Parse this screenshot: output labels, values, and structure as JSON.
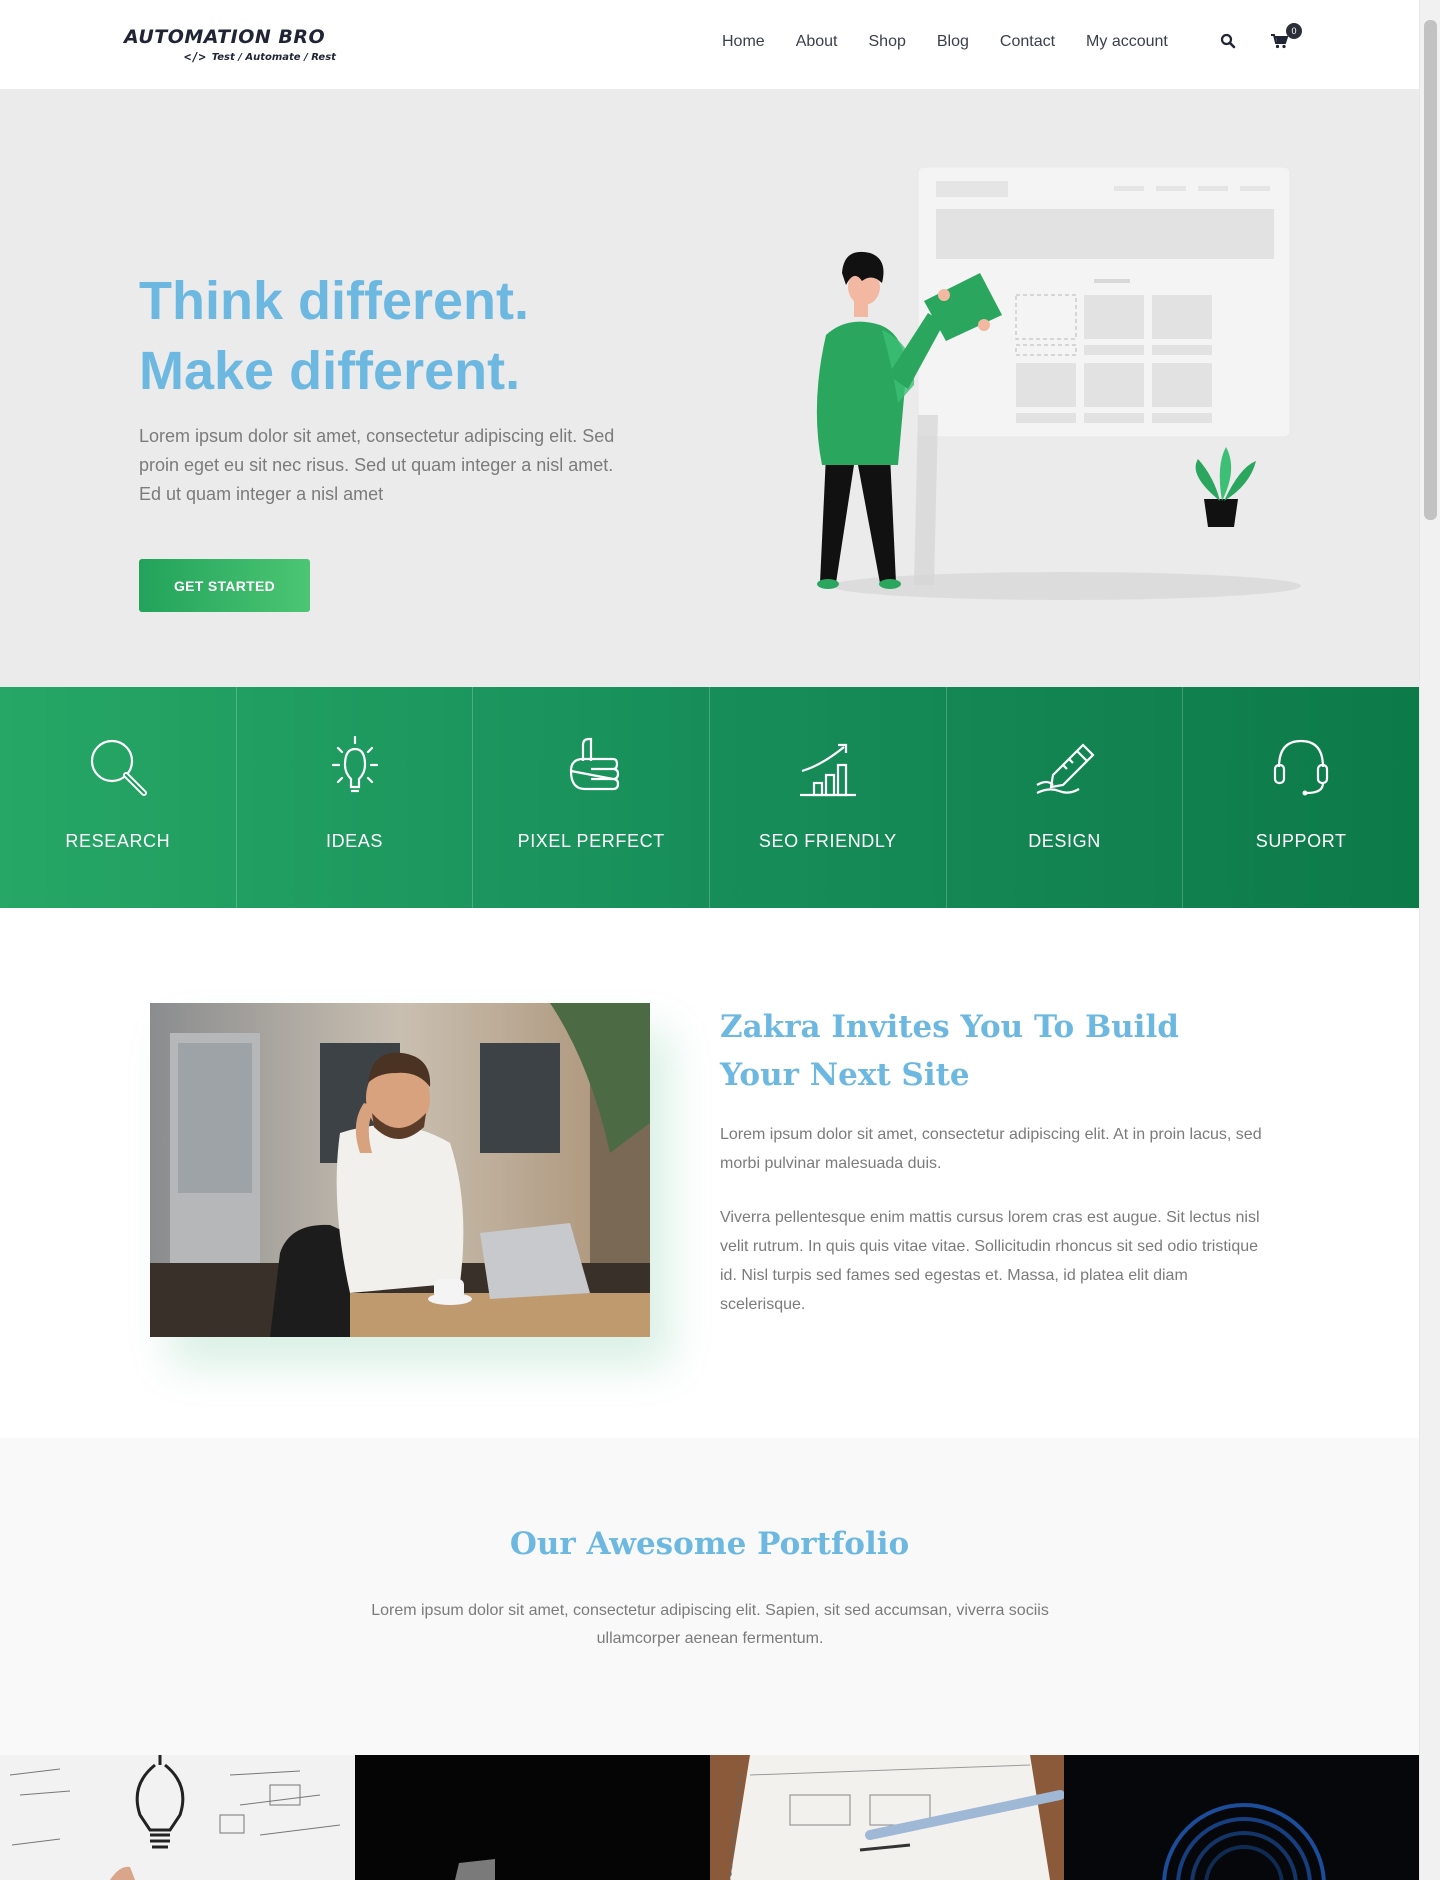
{
  "header": {
    "logo_title": "AUTOMATION BRO",
    "logo_code": "</>",
    "logo_tagline": "Test / Automate / Rest",
    "nav": [
      "Home",
      "About",
      "Shop",
      "Blog",
      "Contact",
      "My account"
    ],
    "cart_count": "0",
    "icons": [
      "search-icon",
      "cart-icon"
    ]
  },
  "hero": {
    "heading_line1": "Think different.",
    "heading_line2": "Make different.",
    "text": "Lorem ipsum dolor sit amet, consectetur adipiscing elit. Sed proin eget eu sit nec risus. Sed ut quam integer a nisl amet.  Ed ut quam integer a nisl amet",
    "button": "GET STARTED"
  },
  "features": [
    {
      "label": "RESEARCH",
      "icon": "magnifier-icon"
    },
    {
      "label": "IDEAS",
      "icon": "lightbulb-icon"
    },
    {
      "label": "PIXEL PERFECT",
      "icon": "thumbs-up-icon"
    },
    {
      "label": "SEO FRIENDLY",
      "icon": "growth-chart-icon"
    },
    {
      "label": "DESIGN",
      "icon": "pencil-icon"
    },
    {
      "label": "SUPPORT",
      "icon": "headset-icon"
    }
  ],
  "about": {
    "title": "Zakra Invites You To Build Your Next Site",
    "paragraph1": "Lorem ipsum dolor sit amet, consectetur adipiscing elit. At in proin lacus, sed morbi pulvinar malesuada duis.",
    "paragraph2": "Viverra pellentesque enim mattis cursus lorem cras est augue. Sit lectus nisl velit rutrum. In quis quis vitae vitae. Sollicitudin rhoncus sit sed odio tristique id. Nisl turpis sed fames sed egestas et. Massa, id platea elit diam scelerisque."
  },
  "portfolio": {
    "title": "Our Awesome Portfolio",
    "text": "Lorem ipsum dolor sit amet, consectetur adipiscing elit. Sapien, sit sed accumsan, viverra sociis ullamcorper aenean fermentum."
  },
  "colors": {
    "accent_blue": "#6cb8e0",
    "brand_green": "#26a765",
    "dark_green": "#0d7a49"
  }
}
